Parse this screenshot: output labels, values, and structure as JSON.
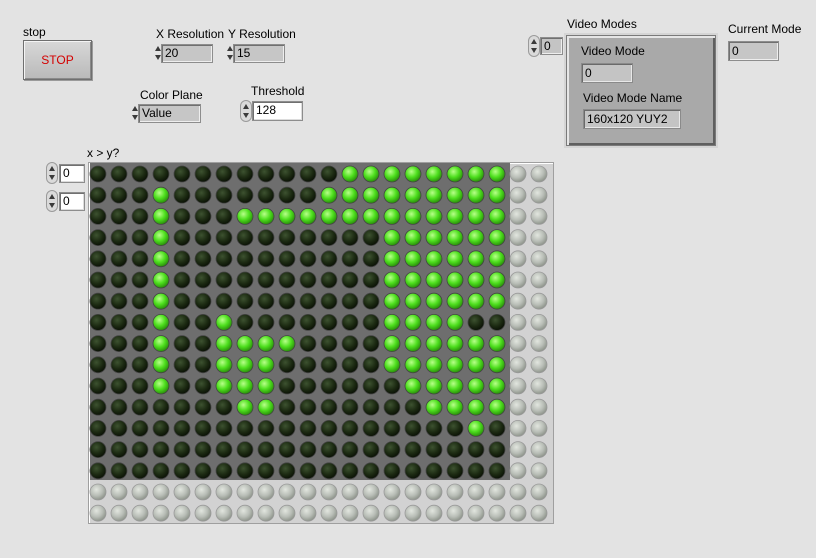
{
  "stop": {
    "label": "stop",
    "button_text": "STOP"
  },
  "x_resolution": {
    "label": "X Resolution",
    "value": "20"
  },
  "y_resolution": {
    "label": "Y Resolution",
    "value": "15"
  },
  "color_plane": {
    "label": "Color Plane",
    "value": "Value"
  },
  "threshold": {
    "label": "Threshold",
    "value": "128"
  },
  "video_modes": {
    "label": "Video Modes",
    "index": "0",
    "mode_label": "Video Mode",
    "mode_value": "0",
    "name_label": "Video Mode Name",
    "name_value": "160x120 YUY2"
  },
  "current_mode": {
    "label": "Current Mode",
    "value": "0"
  },
  "led_array": {
    "label": "x > y?",
    "row_index": "0",
    "col_index": "0",
    "active_columns": 20,
    "active_rows": 15,
    "total_columns": 22,
    "total_rows": 17,
    "colors": {
      "on": "#4ddf1d",
      "off": "#1c2a12",
      "disabled": "#b8bdb6"
    },
    "on_cells": [
      [
        12,
        13,
        14,
        15,
        16,
        17,
        18,
        19
      ],
      [
        3,
        11,
        12,
        13,
        14,
        15,
        16,
        17,
        18,
        19
      ],
      [
        3,
        7,
        8,
        9,
        10,
        11,
        12,
        13,
        14,
        15,
        16,
        17,
        18,
        19
      ],
      [
        3,
        14,
        15,
        16,
        17,
        18,
        19
      ],
      [
        3,
        14,
        15,
        16,
        17,
        18,
        19
      ],
      [
        3,
        14,
        15,
        16,
        17,
        18,
        19
      ],
      [
        3,
        14,
        15,
        16,
        17,
        18,
        19
      ],
      [
        3,
        6,
        14,
        15,
        16,
        17
      ],
      [
        3,
        6,
        7,
        8,
        9,
        14,
        15,
        16,
        17,
        18,
        19
      ],
      [
        3,
        6,
        7,
        8,
        14,
        15,
        16,
        17,
        18,
        19
      ],
      [
        3,
        6,
        7,
        8,
        15,
        16,
        17,
        18,
        19
      ],
      [
        7,
        8,
        16,
        17,
        18,
        19
      ],
      [
        18
      ],
      [],
      []
    ]
  }
}
